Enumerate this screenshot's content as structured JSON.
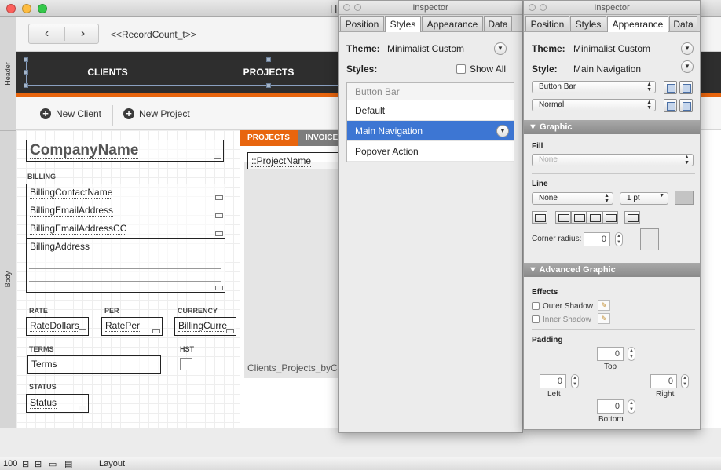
{
  "main": {
    "window_title": "H",
    "record_count": "<<RecordCount_t>>",
    "parts": {
      "header": "Header",
      "body": "Body"
    },
    "nav": {
      "clients": "CLIENTS",
      "projects": "PROJECTS"
    },
    "buttons": {
      "new_client": "New Client",
      "new_project": "New Project"
    },
    "fields": {
      "company": "CompanyName",
      "billing_label": "BILLING",
      "billing_contact": "BillingContactName",
      "billing_email": "BillingEmailAddress",
      "billing_email_cc": "BillingEmailAddressCC",
      "billing_address": "BillingAddress",
      "rate_label": "RATE",
      "per_label": "PER",
      "currency_label": "CURRENCY",
      "rate": "RateDollars",
      "per": "RatePer",
      "currency": "BillingCurre",
      "terms_label": "TERMS",
      "hst_label": "HST",
      "terms": "Terms",
      "status_label": "STATUS",
      "status": "Status"
    },
    "portal": {
      "tab_projects": "PROJECTS",
      "tab_invoices": "INVOICE",
      "field": "::ProjectName",
      "footer": "Clients_Projects_byC"
    },
    "status_bar": {
      "zoom": "100",
      "mode": "Layout"
    }
  },
  "inspector_styles": {
    "title": "Inspector",
    "tabs": [
      "Position",
      "Styles",
      "Appearance",
      "Data"
    ],
    "active_tab": "Styles",
    "theme_label": "Theme:",
    "theme_value": "Minimalist Custom",
    "styles_label": "Styles:",
    "show_all": "Show All",
    "list_header": "Button Bar",
    "list": [
      "Default",
      "Main Navigation",
      "Popover Action"
    ],
    "selected": "Main Navigation"
  },
  "inspector_appearance": {
    "title": "Inspector",
    "tabs": [
      "Position",
      "Styles",
      "Appearance",
      "Data"
    ],
    "active_tab": "Appearance",
    "theme_label": "Theme:",
    "theme_value": "Minimalist Custom",
    "style_label": "Style:",
    "style_value": "Main Navigation",
    "object_popup": "Button Bar",
    "state_popup": "Normal",
    "graphic_section": "Graphic",
    "fill_label": "Fill",
    "fill_value": "None",
    "line_label": "Line",
    "line_value": "None",
    "line_width": "1 pt",
    "corner_radius_label": "Corner radius:",
    "corner_radius": "0",
    "advanced_section": "Advanced Graphic",
    "effects_label": "Effects",
    "outer_shadow": "Outer Shadow",
    "inner_shadow": "Inner Shadow",
    "padding_label": "Padding",
    "padding": {
      "top": "0",
      "left": "0",
      "right": "0",
      "bottom": "0"
    },
    "padding_labels": {
      "top": "Top",
      "left": "Left",
      "right": "Right",
      "bottom": "Bottom"
    }
  },
  "colors": {
    "nav_bg": "#2e2e2e",
    "nav_accent": "#e8650e",
    "selection": "#3d76d3"
  }
}
